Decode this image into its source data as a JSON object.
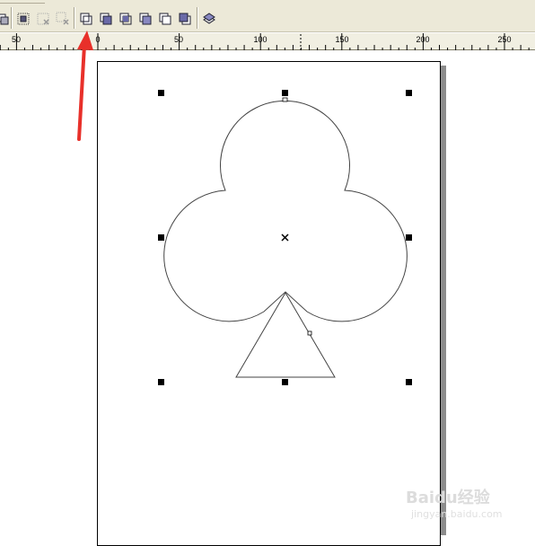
{
  "toolbar": {
    "buttons": [
      {
        "name": "group-icon"
      },
      {
        "name": "ungroup-icon"
      },
      {
        "name": "ungroup-all-icon"
      },
      {
        "name": "weld-icon"
      },
      {
        "name": "trim-icon"
      },
      {
        "name": "intersect-icon"
      },
      {
        "name": "simplify-icon"
      },
      {
        "name": "front-minus-back-icon"
      },
      {
        "name": "back-minus-front-icon"
      },
      {
        "name": "create-boundary-icon"
      }
    ]
  },
  "ruler": {
    "labels": [
      "50",
      "0",
      "50",
      "100",
      "150",
      "200",
      "250"
    ]
  },
  "watermark": {
    "brand": "Baidu经验",
    "url": "jingyan.baidu.com"
  },
  "colors": {
    "toolbar_bg": "#ece9d8",
    "arrow": "#e8302a",
    "shape_stroke": "#444444"
  }
}
